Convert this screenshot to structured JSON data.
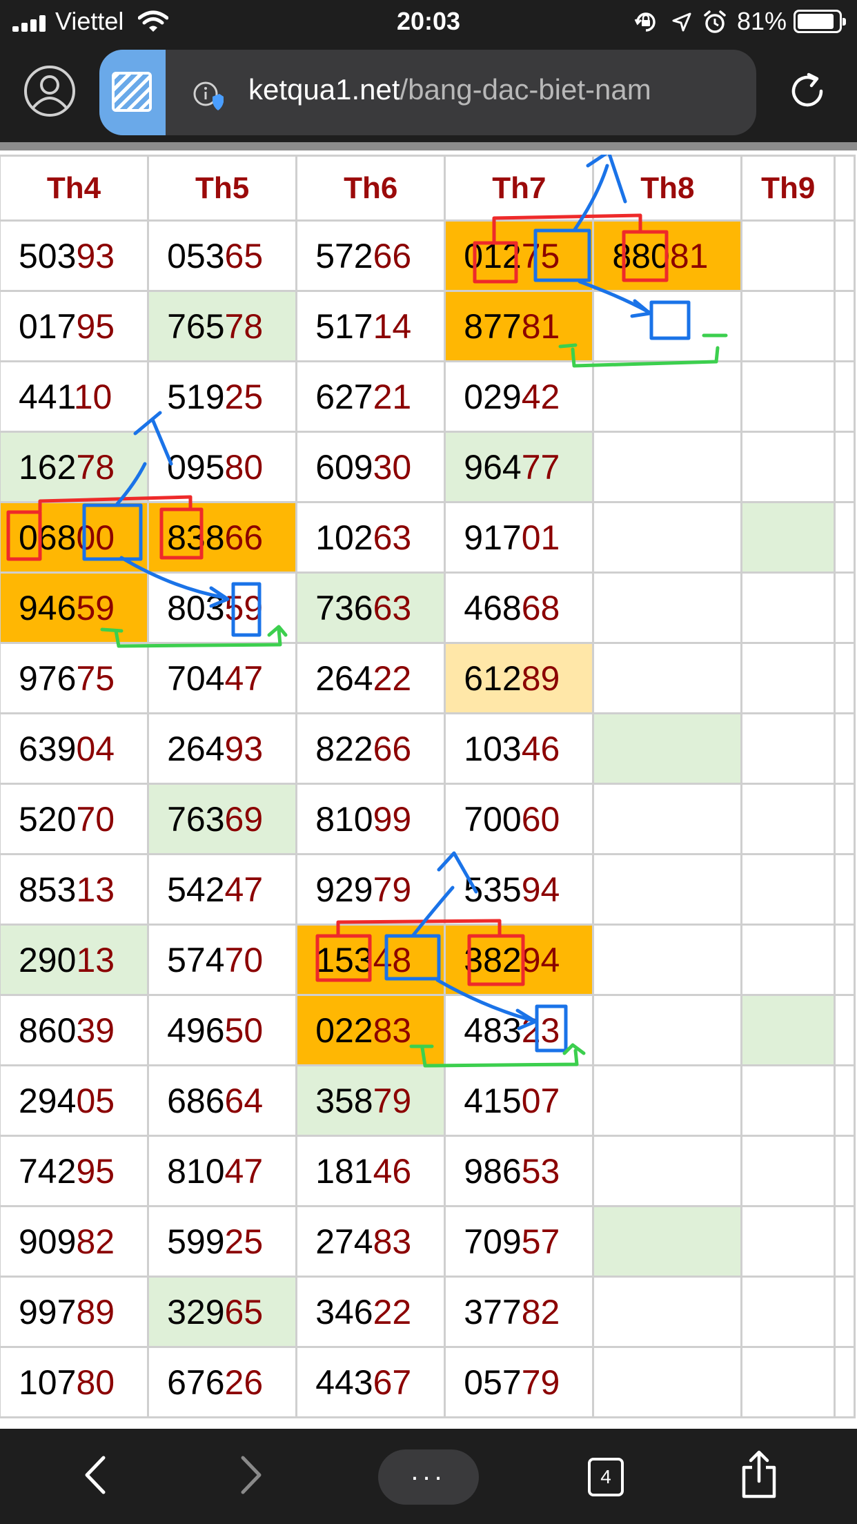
{
  "status_bar": {
    "carrier": "Viettel",
    "time": "20:03",
    "battery_percent": "81%",
    "battery_level": 0.81
  },
  "browser": {
    "url_host": "ketqua1.net",
    "url_path": "/bang-dac-biet-nam",
    "tab_count": "4",
    "menu_label": "..."
  },
  "table": {
    "headers": [
      "Th4",
      "Th5",
      "Th6",
      "Th7",
      "Th8",
      "Th9"
    ],
    "rows": [
      [
        {
          "head": "503",
          "tail": "93"
        },
        {
          "head": "053",
          "tail": "65"
        },
        {
          "head": "572",
          "tail": "66"
        },
        {
          "head": "012",
          "tail": "75",
          "hl": "orange"
        },
        {
          "head": "880",
          "tail": "81",
          "hl": "orange"
        },
        {
          "head": "",
          "tail": ""
        }
      ],
      [
        {
          "head": "017",
          "tail": "95"
        },
        {
          "head": "765",
          "tail": "78",
          "hl": "green"
        },
        {
          "head": "517",
          "tail": "14"
        },
        {
          "head": "877",
          "tail": "81",
          "hl": "orange"
        },
        {
          "head": "",
          "tail": ""
        },
        {
          "head": "",
          "tail": ""
        }
      ],
      [
        {
          "head": "441",
          "tail": "10"
        },
        {
          "head": "519",
          "tail": "25"
        },
        {
          "head": "627",
          "tail": "21"
        },
        {
          "head": "029",
          "tail": "42"
        },
        {
          "head": "",
          "tail": ""
        },
        {
          "head": "",
          "tail": ""
        }
      ],
      [
        {
          "head": "162",
          "tail": "78",
          "hl": "green"
        },
        {
          "head": "095",
          "tail": "80"
        },
        {
          "head": "609",
          "tail": "30"
        },
        {
          "head": "964",
          "tail": "77",
          "hl": "green"
        },
        {
          "head": "",
          "tail": ""
        },
        {
          "head": "",
          "tail": ""
        }
      ],
      [
        {
          "head": "068",
          "tail": "00",
          "hl": "orange"
        },
        {
          "head": "838",
          "tail": "66",
          "hl": "orange"
        },
        {
          "head": "102",
          "tail": "63"
        },
        {
          "head": "917",
          "tail": "01"
        },
        {
          "head": "",
          "tail": ""
        },
        {
          "head": "",
          "tail": "",
          "hl": "green"
        }
      ],
      [
        {
          "head": "946",
          "tail": "59",
          "hl": "orange"
        },
        {
          "head": "803",
          "tail": "59"
        },
        {
          "head": "736",
          "tail": "63",
          "hl": "green"
        },
        {
          "head": "468",
          "tail": "68"
        },
        {
          "head": "",
          "tail": ""
        },
        {
          "head": "",
          "tail": ""
        }
      ],
      [
        {
          "head": "976",
          "tail": "75"
        },
        {
          "head": "704",
          "tail": "47"
        },
        {
          "head": "264",
          "tail": "22"
        },
        {
          "head": "612",
          "tail": "89",
          "hl": "light"
        },
        {
          "head": "",
          "tail": ""
        },
        {
          "head": "",
          "tail": ""
        }
      ],
      [
        {
          "head": "639",
          "tail": "04"
        },
        {
          "head": "264",
          "tail": "93"
        },
        {
          "head": "822",
          "tail": "66"
        },
        {
          "head": "103",
          "tail": "46"
        },
        {
          "head": "",
          "tail": "",
          "hl": "green"
        },
        {
          "head": "",
          "tail": ""
        }
      ],
      [
        {
          "head": "520",
          "tail": "70"
        },
        {
          "head": "763",
          "tail": "69",
          "hl": "green"
        },
        {
          "head": "810",
          "tail": "99"
        },
        {
          "head": "700",
          "tail": "60"
        },
        {
          "head": "",
          "tail": ""
        },
        {
          "head": "",
          "tail": ""
        }
      ],
      [
        {
          "head": "853",
          "tail": "13"
        },
        {
          "head": "542",
          "tail": "47"
        },
        {
          "head": "929",
          "tail": "79"
        },
        {
          "head": "535",
          "tail": "94"
        },
        {
          "head": "",
          "tail": ""
        },
        {
          "head": "",
          "tail": ""
        }
      ],
      [
        {
          "head": "290",
          "tail": "13",
          "hl": "green"
        },
        {
          "head": "574",
          "tail": "70"
        },
        {
          "head": "153",
          "tail": "48",
          "hl": "orange"
        },
        {
          "head": "382",
          "tail": "94",
          "hl": "orange"
        },
        {
          "head": "",
          "tail": ""
        },
        {
          "head": "",
          "tail": ""
        }
      ],
      [
        {
          "head": "860",
          "tail": "39"
        },
        {
          "head": "496",
          "tail": "50"
        },
        {
          "head": "022",
          "tail": "83",
          "hl": "orange"
        },
        {
          "head": "483",
          "tail": "23"
        },
        {
          "head": "",
          "tail": ""
        },
        {
          "head": "",
          "tail": "",
          "hl": "green"
        }
      ],
      [
        {
          "head": "294",
          "tail": "05"
        },
        {
          "head": "686",
          "tail": "64"
        },
        {
          "head": "358",
          "tail": "79",
          "hl": "green"
        },
        {
          "head": "415",
          "tail": "07"
        },
        {
          "head": "",
          "tail": ""
        },
        {
          "head": "",
          "tail": ""
        }
      ],
      [
        {
          "head": "742",
          "tail": "95"
        },
        {
          "head": "810",
          "tail": "47"
        },
        {
          "head": "181",
          "tail": "46"
        },
        {
          "head": "986",
          "tail": "53"
        },
        {
          "head": "",
          "tail": ""
        },
        {
          "head": "",
          "tail": ""
        }
      ],
      [
        {
          "head": "909",
          "tail": "82"
        },
        {
          "head": "599",
          "tail": "25"
        },
        {
          "head": "274",
          "tail": "83"
        },
        {
          "head": "709",
          "tail": "57"
        },
        {
          "head": "",
          "tail": "",
          "hl": "green"
        },
        {
          "head": "",
          "tail": ""
        }
      ],
      [
        {
          "head": "997",
          "tail": "89"
        },
        {
          "head": "329",
          "tail": "65",
          "hl": "green"
        },
        {
          "head": "346",
          "tail": "22"
        },
        {
          "head": "377",
          "tail": "82"
        },
        {
          "head": "",
          "tail": ""
        },
        {
          "head": "",
          "tail": ""
        }
      ],
      [
        {
          "head": "107",
          "tail": "80"
        },
        {
          "head": "676",
          "tail": "26"
        },
        {
          "head": "443",
          "tail": "67"
        },
        {
          "head": "057",
          "tail": "79"
        },
        {
          "head": "",
          "tail": ""
        },
        {
          "head": "",
          "tail": ""
        }
      ]
    ]
  },
  "colors": {
    "header_text": "#9b0a0a",
    "tail_digits": "#8b0000",
    "highlight_orange": "#ffb703",
    "highlight_light": "#ffe7a8",
    "highlight_green": "#dff0d8",
    "annotation_red": "#ee2a2a",
    "annotation_blue": "#1a73e8",
    "annotation_green": "#3ccf4e"
  },
  "icons": [
    "signal-icon",
    "wifi-icon",
    "orientation-lock-icon",
    "location-icon",
    "alarm-icon",
    "battery-icon",
    "profile-icon",
    "tab-thumbnail-icon",
    "site-info-icon",
    "reload-icon",
    "back-icon",
    "forward-icon",
    "tabs-icon",
    "share-icon"
  ]
}
